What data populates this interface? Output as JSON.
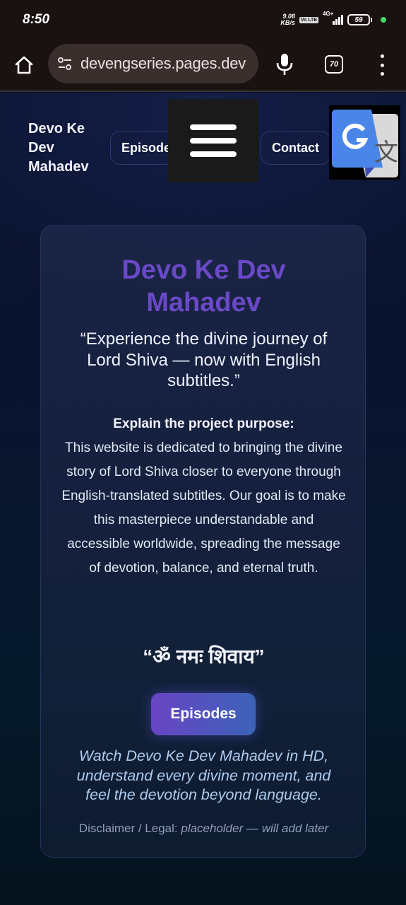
{
  "status_bar": {
    "time": "8:50",
    "net_speed_value": "9.08",
    "net_speed_unit": "KB/s",
    "volte": "Vo LTE",
    "network": "4G+",
    "battery": "59"
  },
  "browser": {
    "url": "devengseries.pages.dev",
    "tab_count": "70"
  },
  "nav": {
    "brand": "Devo Ke Dev Mahadev",
    "episodes_label": "Episodes",
    "contact_label": "Contact"
  },
  "hero": {
    "title": "Devo Ke Dev Mahadev",
    "tagline": "“Experience the divine journey of Lord Shiva — now with English subtitles.”",
    "purpose_heading": "Explain the project purpose:",
    "purpose_body": "This website is dedicated to bringing the divine story of Lord Shiva closer to everyone through English-translated subtitles. Our goal is to make this masterpiece understandable and accessible worldwide, spreading the message of devotion, balance, and eternal truth.",
    "mantra": "“ॐ नमः शिवाय”",
    "cta_label": "Episodes",
    "watch_text": "Watch Devo Ke Dev Mahadev in HD, understand every divine moment, and feel the devotion beyond language.",
    "disclaimer_label": "Disclaimer / Legal:",
    "disclaimer_value": "placeholder — will add later"
  },
  "colors": {
    "title_purple": "#6a49c6",
    "button_start": "#6a44c4",
    "button_end": "#3b63b8",
    "italic_blue": "#aecbed",
    "page_bg": "#0a1430"
  },
  "icons": [
    "home-icon",
    "tune-icon",
    "mic-icon",
    "tab-switcher-icon",
    "more-vert-icon",
    "hamburger-menu-icon",
    "google-translate-icon"
  ]
}
